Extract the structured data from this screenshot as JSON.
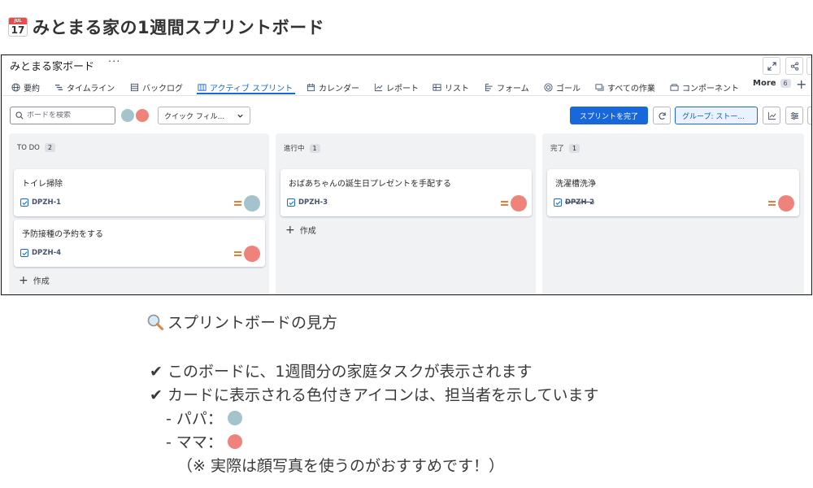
{
  "page": {
    "title_icon": "calendar-icon",
    "calendar_month": "JUL",
    "calendar_day": "17",
    "title": "みとまる家の1週間スプリントボード"
  },
  "colors": {
    "papa": "#a5c3cc",
    "mama": "#f0827c",
    "accent": "#1868db",
    "priority": "#e2803a"
  },
  "board": {
    "name": "みとまる家ボード",
    "more": "···",
    "header_icons": [
      "expand-icon",
      "share-icon"
    ]
  },
  "tabs": [
    {
      "label": "要約",
      "icon": "globe-icon"
    },
    {
      "label": "タイムライン",
      "icon": "timeline-icon"
    },
    {
      "label": "バックログ",
      "icon": "backlog-icon"
    },
    {
      "label": "アクティブ スプリント",
      "icon": "board-icon",
      "active": true
    },
    {
      "label": "カレンダー",
      "icon": "calendar-icon"
    },
    {
      "label": "レポート",
      "icon": "chart-icon"
    },
    {
      "label": "リスト",
      "icon": "list-icon"
    },
    {
      "label": "フォーム",
      "icon": "form-icon"
    },
    {
      "label": "ゴール",
      "icon": "target-icon"
    },
    {
      "label": "すべての作業",
      "icon": "stack-icon"
    },
    {
      "label": "コンポーネント",
      "icon": "component-icon"
    }
  ],
  "tabs_more": {
    "label": "More",
    "count": "6"
  },
  "toolbar": {
    "search_placeholder": "ボードを検索",
    "quick_filter": "クイック フィル...",
    "complete_sprint": "スプリントを完了",
    "group": "グループ: ストー..."
  },
  "columns": [
    {
      "name": "TO DO",
      "count": "2",
      "cards": [
        {
          "title": "トイレ掃除",
          "key": "DPZH-1",
          "assignee": "papa"
        },
        {
          "title": "予防接種の予約をする",
          "key": "DPZH-4",
          "assignee": "mama"
        }
      ],
      "create": "作成"
    },
    {
      "name": "進行中",
      "count": "1",
      "cards": [
        {
          "title": "おばあちゃんの誕生日プレゼントを手配する",
          "key": "DPZH-3",
          "assignee": "mama"
        }
      ],
      "create": "作成"
    },
    {
      "name": "完了",
      "count": "1",
      "cards": [
        {
          "title": "洗濯槽洗浄",
          "key": "DPZH-2",
          "assignee": "mama",
          "done": true
        }
      ]
    }
  ],
  "explanation": {
    "heading": "スプリントボードの見方",
    "bullet1": "✔︎ このボードに、1週間分の家庭タスクが表示されます",
    "bullet2": "✔︎ カードに表示される色付きアイコンは、担当者を示しています",
    "papa": "- パパ：",
    "mama": "- ママ：",
    "note": "（※ 実際は顔写真を使うのがおすすめです！）"
  }
}
